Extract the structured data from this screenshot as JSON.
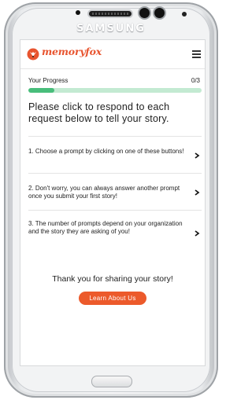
{
  "device": {
    "brand": "SAMSUNG"
  },
  "header": {
    "logo_text": "memoryfox",
    "menu_icon": "hamburger-menu-icon",
    "brand_color": "#e8542f"
  },
  "progress": {
    "label": "Your Progress",
    "count_text": "0/3",
    "completed": 0,
    "total": 3,
    "fill_fraction": 0.15,
    "fill_color": "#48bd7b",
    "track_color": "#c3ead2"
  },
  "main": {
    "heading": "Please click to respond to each request below to tell your story.",
    "prompts": [
      {
        "text": "1. Choose a prompt by clicking on one of these buttons!",
        "icon": "chevron-right-icon"
      },
      {
        "text": "2. Don't worry, you can always answer another prompt once you submit your first story!",
        "icon": "chevron-right-icon"
      },
      {
        "text": "3. The number of prompts depend on your organization and the story they are asking of you!",
        "icon": "chevron-right-icon"
      }
    ],
    "thanks_text": "Thank you for sharing your story!",
    "learn_button_label": "Learn About Us",
    "accent_color": "#ec5a2b"
  }
}
